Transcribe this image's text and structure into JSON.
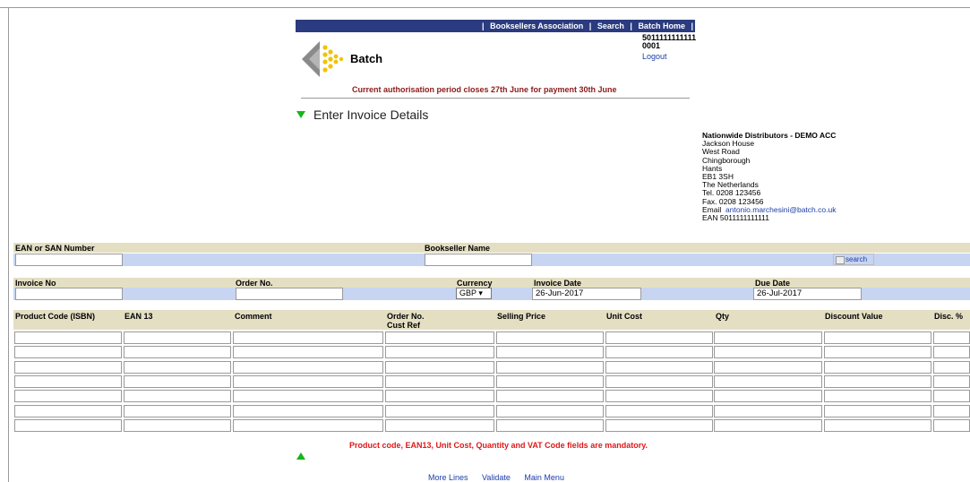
{
  "nav": {
    "links": [
      "Booksellers Association",
      "Search",
      "Batch Home"
    ],
    "separator": "|"
  },
  "header": {
    "brand": "Batch",
    "account_line1": "5011111111111",
    "account_line2": "0001",
    "logout": "Logout",
    "notice": "Current authorisation period closes 27th June for payment 30th June"
  },
  "section_title": "Enter Invoice Details",
  "address": {
    "company": "Nationwide Distributors - DEMO ACC",
    "lines": [
      "Jackson House",
      "West Road",
      "Chingborough",
      "Hants",
      "EB1 3SH",
      "The Netherlands"
    ],
    "tel": "Tel.  0208 123456",
    "fax": "Fax.  0208 123456",
    "email_label": "Email",
    "email": "antonio.marchesini@batch.co.uk",
    "ean": "EAN  5011111111111"
  },
  "form": {
    "ean_san_label": "EAN or SAN Number",
    "ean_san_value": "",
    "bookseller_name_label": "Bookseller Name",
    "bookseller_name_value": "",
    "search_label": "search",
    "invoice_no_label": "Invoice No",
    "invoice_no_value": "",
    "order_no_label": "Order No.",
    "order_no_value": "",
    "currency_label": "Currency",
    "currency_value": "GBP ▾",
    "invoice_date_label": "Invoice Date",
    "invoice_date_value": "26-Jun-2017",
    "due_date_label": "Due Date",
    "due_date_value": "26-Jul-2017"
  },
  "grid": {
    "columns": [
      "Product Code (ISBN)",
      "EAN 13",
      "Comment",
      "Order No. Cust Ref",
      "Selling Price",
      "Unit Cost",
      "Qty",
      "Discount Value",
      "Disc. %"
    ],
    "row_count": 7
  },
  "footer": {
    "mandatory": "Product code, EAN13, Unit Cost, Quantity and VAT Code fields are mandatory.",
    "links": [
      "More Lines",
      "Validate",
      "Main Menu"
    ]
  },
  "colors": {
    "nav_bg": "#2b3b80",
    "band_tan": "#e4dfc3",
    "band_blue": "#c7d5f2",
    "notice_red": "#8b1a1a",
    "mandatory_red": "#e01818",
    "link_blue": "#1a3ea8",
    "arrow_green": "#18b51a"
  }
}
